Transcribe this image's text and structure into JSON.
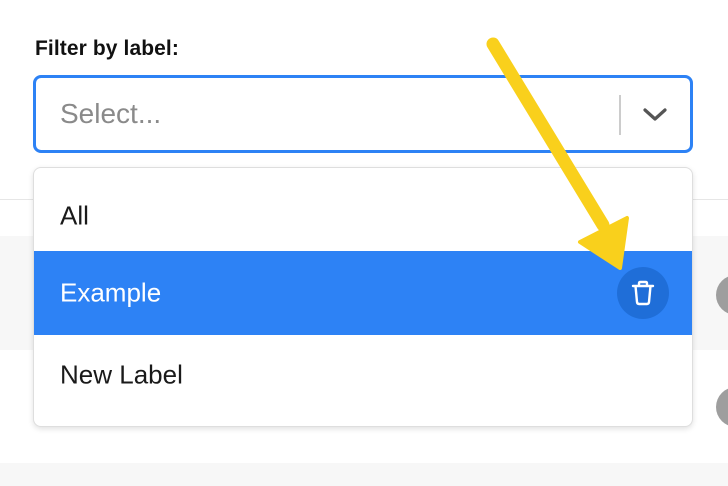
{
  "filter": {
    "label": "Filter by label:",
    "placeholder": "Select..."
  },
  "menu": {
    "options": [
      {
        "label": "All"
      },
      {
        "label": "Example",
        "highlighted": true
      },
      {
        "label": "New Label"
      }
    ]
  },
  "icons": {
    "dropdown": "chevron-down-icon",
    "delete": "trash-icon"
  },
  "colors": {
    "accent": "#2d82f5",
    "highlight": "#2d82f5",
    "delete_button": "#1f6ed8",
    "annotation_arrow": "#f9d01c"
  }
}
